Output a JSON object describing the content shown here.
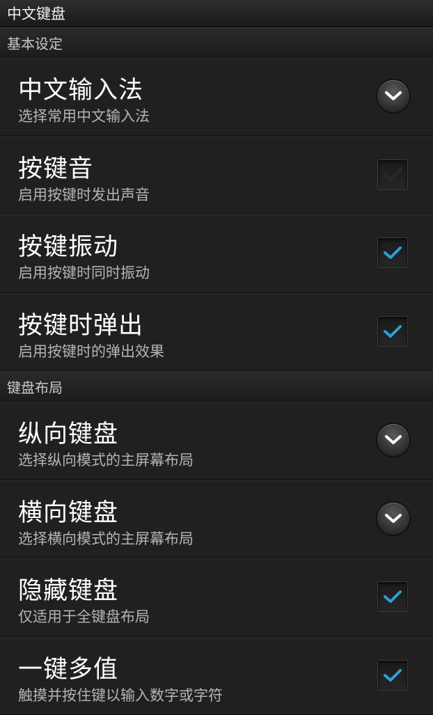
{
  "title": "中文键盘",
  "sections": [
    {
      "header": "基本设定",
      "rows": [
        {
          "title": "中文输入法",
          "subtitle": "选择常用中文输入法",
          "control": "dropdown"
        },
        {
          "title": "按键音",
          "subtitle": "启用按键时发出声音",
          "control": "checkbox",
          "checked": false
        },
        {
          "title": "按键振动",
          "subtitle": "启用按键时同时振动",
          "control": "checkbox",
          "checked": true
        },
        {
          "title": "按键时弹出",
          "subtitle": "启用按键时的弹出效果",
          "control": "checkbox",
          "checked": true
        }
      ]
    },
    {
      "header": "键盘布局",
      "rows": [
        {
          "title": "纵向键盘",
          "subtitle": "选择纵向模式的主屏幕布局",
          "control": "dropdown"
        },
        {
          "title": "横向键盘",
          "subtitle": "选择横向模式的主屏幕布局",
          "control": "dropdown"
        },
        {
          "title": "隐藏键盘",
          "subtitle": "仅适用于全键盘布局",
          "control": "checkbox",
          "checked": true
        },
        {
          "title": "一键多值",
          "subtitle": "触摸并按住键以输入数字或字符",
          "control": "checkbox",
          "checked": true
        }
      ]
    }
  ],
  "colors": {
    "check_on": "#2e9fd8",
    "check_off": "#2a2a2a",
    "chevron": "#ffffff"
  }
}
